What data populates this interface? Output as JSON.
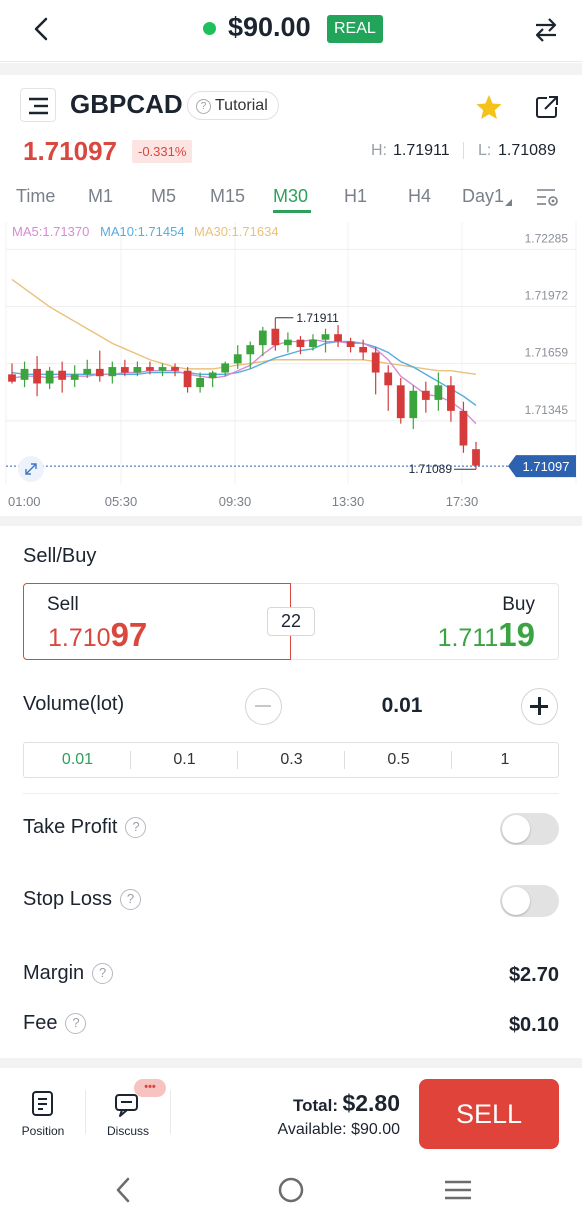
{
  "topbar": {
    "balance": "$90.00",
    "account_badge": "REAL",
    "status_color": "#1fbf5b"
  },
  "instrument": {
    "symbol": "GBPCAD",
    "tutorial_label": "Tutorial",
    "price": "1.71097",
    "change": "-0.331%",
    "high_label": "H:",
    "high": "1.71911",
    "low_label": "L:",
    "low": "1.71089"
  },
  "timeframes": [
    "Time",
    "M1",
    "M5",
    "M15",
    "M30",
    "H1",
    "H4",
    "Day1"
  ],
  "active_timeframe": "M30",
  "chart_data": {
    "type": "candlestick",
    "ma_legend": [
      {
        "label": "MA5:1.71370",
        "color": "#d98ad6"
      },
      {
        "label": "MA10:1.71454",
        "color": "#55aee0"
      },
      {
        "label": "MA30:1.71634",
        "color": "#eac17a"
      }
    ],
    "y_ticks": [
      "1.72285",
      "1.71972",
      "1.71659",
      "1.71345"
    ],
    "ylim": [
      1.71032,
      1.72435
    ],
    "x_ticks": [
      "01:00",
      "05:30",
      "09:30",
      "13:30",
      "17:30"
    ],
    "high_marker": "1.71911",
    "low_marker": "1.71089",
    "current_price": "1.71097",
    "up_color": "#3ba43c",
    "down_color": "#d63b3b",
    "candles": [
      {
        "o": 1.716,
        "h": 1.7166,
        "l": 1.7155,
        "c": 1.7156
      },
      {
        "o": 1.7157,
        "h": 1.7167,
        "l": 1.7153,
        "c": 1.7163
      },
      {
        "o": 1.7163,
        "h": 1.717,
        "l": 1.7148,
        "c": 1.7155
      },
      {
        "o": 1.7155,
        "h": 1.7164,
        "l": 1.7152,
        "c": 1.7162
      },
      {
        "o": 1.7162,
        "h": 1.7167,
        "l": 1.715,
        "c": 1.7157
      },
      {
        "o": 1.7157,
        "h": 1.7165,
        "l": 1.7153,
        "c": 1.716
      },
      {
        "o": 1.716,
        "h": 1.7168,
        "l": 1.7158,
        "c": 1.7163
      },
      {
        "o": 1.7163,
        "h": 1.7173,
        "l": 1.7156,
        "c": 1.7159
      },
      {
        "o": 1.7159,
        "h": 1.7167,
        "l": 1.7155,
        "c": 1.7164
      },
      {
        "o": 1.7164,
        "h": 1.7168,
        "l": 1.7159,
        "c": 1.7161
      },
      {
        "o": 1.7161,
        "h": 1.7167,
        "l": 1.7159,
        "c": 1.7164
      },
      {
        "o": 1.7164,
        "h": 1.7167,
        "l": 1.716,
        "c": 1.7162
      },
      {
        "o": 1.7162,
        "h": 1.7166,
        "l": 1.7159,
        "c": 1.7164
      },
      {
        "o": 1.7164,
        "h": 1.7166,
        "l": 1.7159,
        "c": 1.7162
      },
      {
        "o": 1.7162,
        "h": 1.7164,
        "l": 1.715,
        "c": 1.7153
      },
      {
        "o": 1.7153,
        "h": 1.7161,
        "l": 1.715,
        "c": 1.7158
      },
      {
        "o": 1.7158,
        "h": 1.7162,
        "l": 1.7153,
        "c": 1.7161
      },
      {
        "o": 1.7161,
        "h": 1.7167,
        "l": 1.7159,
        "c": 1.7166
      },
      {
        "o": 1.7166,
        "h": 1.7176,
        "l": 1.7163,
        "c": 1.7171
      },
      {
        "o": 1.7171,
        "h": 1.7178,
        "l": 1.7163,
        "c": 1.7176
      },
      {
        "o": 1.7176,
        "h": 1.7186,
        "l": 1.717,
        "c": 1.7184
      },
      {
        "o": 1.7185,
        "h": 1.7191,
        "l": 1.7173,
        "c": 1.7176
      },
      {
        "o": 1.7176,
        "h": 1.7183,
        "l": 1.7172,
        "c": 1.7179
      },
      {
        "o": 1.7179,
        "h": 1.7181,
        "l": 1.7171,
        "c": 1.7175
      },
      {
        "o": 1.7175,
        "h": 1.7182,
        "l": 1.7173,
        "c": 1.7179
      },
      {
        "o": 1.7179,
        "h": 1.7185,
        "l": 1.7172,
        "c": 1.7182
      },
      {
        "o": 1.7182,
        "h": 1.7187,
        "l": 1.7175,
        "c": 1.7178
      },
      {
        "o": 1.7178,
        "h": 1.718,
        "l": 1.7172,
        "c": 1.7175
      },
      {
        "o": 1.7175,
        "h": 1.7179,
        "l": 1.7168,
        "c": 1.7172
      },
      {
        "o": 1.7172,
        "h": 1.7175,
        "l": 1.7149,
        "c": 1.7161
      },
      {
        "o": 1.7161,
        "h": 1.7165,
        "l": 1.714,
        "c": 1.7154
      },
      {
        "o": 1.7154,
        "h": 1.7158,
        "l": 1.7133,
        "c": 1.7136
      },
      {
        "o": 1.7136,
        "h": 1.7154,
        "l": 1.713,
        "c": 1.7151
      },
      {
        "o": 1.7151,
        "h": 1.7156,
        "l": 1.7139,
        "c": 1.7146
      },
      {
        "o": 1.7146,
        "h": 1.7161,
        "l": 1.714,
        "c": 1.7154
      },
      {
        "o": 1.7154,
        "h": 1.7159,
        "l": 1.7134,
        "c": 1.714
      },
      {
        "o": 1.714,
        "h": 1.7145,
        "l": 1.7117,
        "c": 1.7121
      },
      {
        "o": 1.7119,
        "h": 1.7123,
        "l": 1.7108,
        "c": 1.711
      }
    ],
    "ma5": [
      1.7158,
      1.7159,
      1.7159,
      1.7158,
      1.7159,
      1.7159,
      1.7159,
      1.716,
      1.716,
      1.7161,
      1.7161,
      1.7162,
      1.7162,
      1.7162,
      1.716,
      1.7159,
      1.7158,
      1.7159,
      1.7162,
      1.7165,
      1.7171,
      1.7176,
      1.7178,
      1.7178,
      1.7179,
      1.7178,
      1.7178,
      1.7177,
      1.7177,
      1.7174,
      1.7168,
      1.7159,
      1.7154,
      1.7149,
      1.7148,
      1.7145,
      1.714,
      1.7133
    ],
    "ma10": [
      1.7161,
      1.716,
      1.716,
      1.716,
      1.716,
      1.716,
      1.716,
      1.716,
      1.716,
      1.716,
      1.716,
      1.7161,
      1.7161,
      1.7161,
      1.7161,
      1.716,
      1.716,
      1.716,
      1.7161,
      1.7163,
      1.7166,
      1.7169,
      1.7171,
      1.7173,
      1.7174,
      1.7177,
      1.7178,
      1.7178,
      1.7177,
      1.7175,
      1.7172,
      1.7167,
      1.7164,
      1.716,
      1.7156,
      1.7152,
      1.7148,
      1.7143
    ],
    "ma30": [
      1.7212,
      1.7207,
      1.7202,
      1.7197,
      1.7193,
      1.7189,
      1.7185,
      1.7181,
      1.7177,
      1.7174,
      1.7171,
      1.7168,
      1.7166,
      1.7164,
      1.7163,
      1.7163,
      1.7163,
      1.7164,
      1.7165,
      1.7166,
      1.7167,
      1.7168,
      1.7168,
      1.7168,
      1.7168,
      1.7168,
      1.7168,
      1.7168,
      1.7168,
      1.7167,
      1.7166,
      1.7165,
      1.7164,
      1.7163,
      1.7162,
      1.7162,
      1.7161,
      1.716
    ]
  },
  "trade": {
    "section_title": "Sell/Buy",
    "sell_label": "Sell",
    "sell_price_main": "1.710",
    "sell_price_big": "97",
    "spread": "22",
    "buy_label": "Buy",
    "buy_price_main": "1.711",
    "buy_price_big": "19",
    "volume_label": "Volume(lot)",
    "volume_value": "0.01",
    "lot_options": [
      "0.01",
      "0.1",
      "0.3",
      "0.5",
      "1"
    ],
    "take_profit_label": "Take Profit",
    "stop_loss_label": "Stop Loss",
    "margin_label": "Margin",
    "margin_value": "$2.70",
    "fee_label": "Fee",
    "fee_value": "$0.10"
  },
  "bottom": {
    "position_label": "Position",
    "discuss_label": "Discuss",
    "discuss_badge": "•••",
    "total_label": "Total:",
    "total_value": "$2.80",
    "available_label": "Available:",
    "available_value": "$90.00",
    "sell_button": "SELL",
    "sell_color": "#e0433a"
  }
}
